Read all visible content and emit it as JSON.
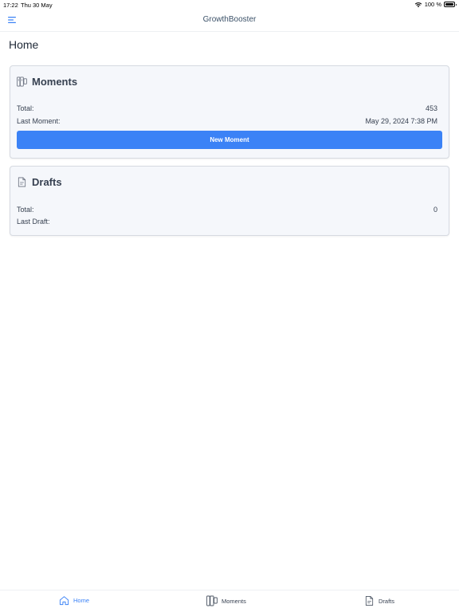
{
  "status_bar": {
    "time": "17:22",
    "date": "Thu 30 May",
    "battery": "100 %"
  },
  "header": {
    "title": "GrowthBooster"
  },
  "page": {
    "title": "Home"
  },
  "moments_card": {
    "title": "Moments",
    "total_label": "Total:",
    "total_value": "453",
    "last_label": "Last Moment:",
    "last_value": "May 29, 2024 7:38 PM",
    "button_label": "New Moment"
  },
  "drafts_card": {
    "title": "Drafts",
    "total_label": "Total:",
    "total_value": "0",
    "last_label": "Last Draft:",
    "last_value": ""
  },
  "tabs": [
    {
      "label": "Home",
      "icon": "home-icon",
      "active": true
    },
    {
      "label": "Moments",
      "icon": "moments-icon",
      "active": false
    },
    {
      "label": "Drafts",
      "icon": "document-icon",
      "active": false
    }
  ],
  "colors": {
    "accent": "#3b82f6",
    "card_bg": "#f5f7fb",
    "card_border": "#d6dae1"
  }
}
